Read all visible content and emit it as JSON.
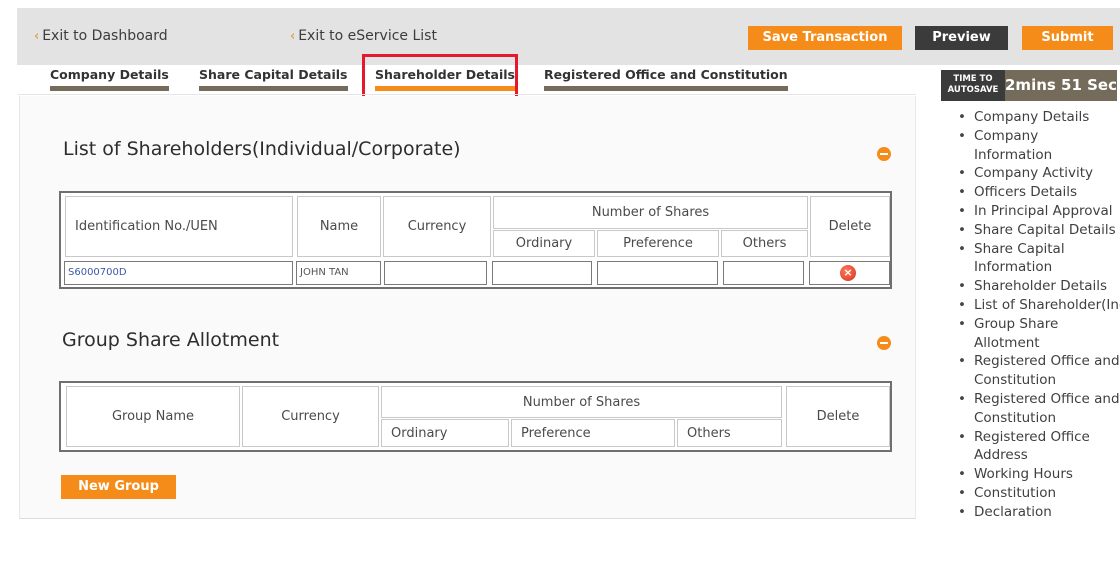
{
  "topbar": {
    "exit_dashboard": "Exit to Dashboard",
    "exit_eservice": "Exit to eService List",
    "save_label": "Save Transaction",
    "preview_label": "Preview",
    "submit_label": "Submit"
  },
  "tabs": [
    {
      "label": "Company Details",
      "active": false
    },
    {
      "label": "Share Capital Details",
      "active": false
    },
    {
      "label": "Shareholder Details",
      "active": true
    },
    {
      "label": "Registered Office and Constitution",
      "active": false
    }
  ],
  "shareholders": {
    "title": "List of Shareholders(Individual/Corporate)",
    "headers": {
      "id": "Identification No./UEN",
      "name": "Name",
      "currency": "Currency",
      "number_of_shares": "Number of Shares",
      "ordinary": "Ordinary",
      "preference": "Preference",
      "others": "Others",
      "delete": "Delete"
    },
    "rows": [
      {
        "id": "S6000700D",
        "name": "JOHN TAN",
        "currency": "",
        "ordinary": "",
        "preference": "",
        "others": ""
      }
    ]
  },
  "group_allotment": {
    "title": "Group Share Allotment",
    "headers": {
      "group_name": "Group Name",
      "currency": "Currency",
      "number_of_shares": "Number of Shares",
      "ordinary": "Ordinary",
      "preference": "Preference",
      "others": "Others",
      "delete": "Delete"
    },
    "new_group_label": "New Group"
  },
  "autosave": {
    "label_line1": "TIME TO",
    "label_line2": "AUTOSAVE",
    "time": "2mins 51 Sec"
  },
  "sidebar": {
    "items": [
      "Company Details",
      "Company Information",
      "Company Activity",
      "Officers Details",
      "In Principal Approval",
      "Share Capital Details",
      "Share Capital Information",
      "Shareholder Details",
      "List of Shareholder(Individu",
      "Group Share Allotment",
      "Registered Office and Constitution",
      "Registered Office and Constitution",
      "Registered Office Address",
      "Working Hours",
      "Constitution",
      "Declaration"
    ]
  },
  "colors": {
    "accent": "#f58c1a",
    "dark_button": "#3b3b3b",
    "tab_underline": "#756b5a",
    "highlight": "#e6192c"
  }
}
